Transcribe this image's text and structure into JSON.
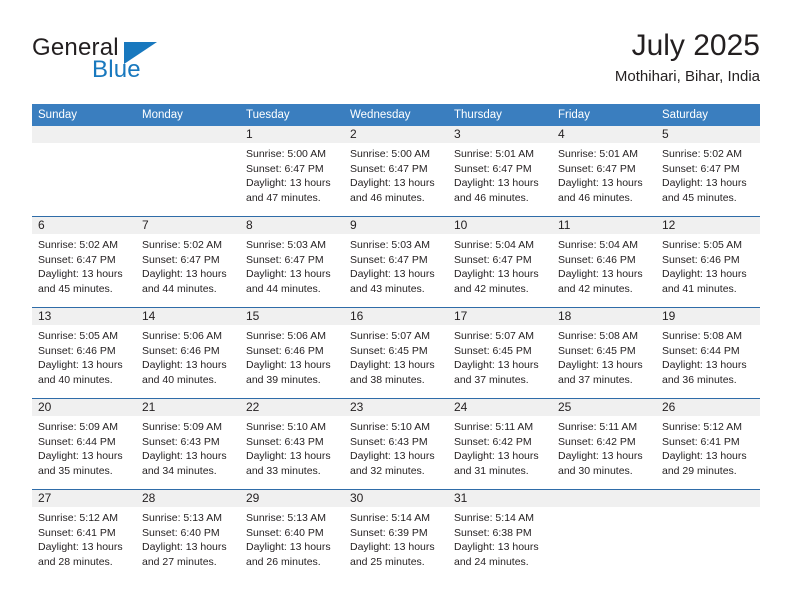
{
  "brand": {
    "name_top": "General",
    "name_bottom": "Blue",
    "triangle_icon": "triangle-icon",
    "accent_color": "#1878be"
  },
  "header": {
    "title": "July 2025",
    "subtitle": "Mothihari, Bihar, India"
  },
  "theme": {
    "header_blue": "#3a7ebf",
    "row_line_blue": "#2f6ca8",
    "daynum_band": "#f0f0f0"
  },
  "weekday_headers": [
    "Sunday",
    "Monday",
    "Tuesday",
    "Wednesday",
    "Thursday",
    "Friday",
    "Saturday"
  ],
  "weeks": [
    {
      "days": [
        {
          "num": "",
          "lines": []
        },
        {
          "num": "",
          "lines": []
        },
        {
          "num": "1",
          "lines": [
            "Sunrise: 5:00 AM",
            "Sunset: 6:47 PM",
            "Daylight: 13 hours",
            "and 47 minutes."
          ]
        },
        {
          "num": "2",
          "lines": [
            "Sunrise: 5:00 AM",
            "Sunset: 6:47 PM",
            "Daylight: 13 hours",
            "and 46 minutes."
          ]
        },
        {
          "num": "3",
          "lines": [
            "Sunrise: 5:01 AM",
            "Sunset: 6:47 PM",
            "Daylight: 13 hours",
            "and 46 minutes."
          ]
        },
        {
          "num": "4",
          "lines": [
            "Sunrise: 5:01 AM",
            "Sunset: 6:47 PM",
            "Daylight: 13 hours",
            "and 46 minutes."
          ]
        },
        {
          "num": "5",
          "lines": [
            "Sunrise: 5:02 AM",
            "Sunset: 6:47 PM",
            "Daylight: 13 hours",
            "and 45 minutes."
          ]
        }
      ]
    },
    {
      "days": [
        {
          "num": "6",
          "lines": [
            "Sunrise: 5:02 AM",
            "Sunset: 6:47 PM",
            "Daylight: 13 hours",
            "and 45 minutes."
          ]
        },
        {
          "num": "7",
          "lines": [
            "Sunrise: 5:02 AM",
            "Sunset: 6:47 PM",
            "Daylight: 13 hours",
            "and 44 minutes."
          ]
        },
        {
          "num": "8",
          "lines": [
            "Sunrise: 5:03 AM",
            "Sunset: 6:47 PM",
            "Daylight: 13 hours",
            "and 44 minutes."
          ]
        },
        {
          "num": "9",
          "lines": [
            "Sunrise: 5:03 AM",
            "Sunset: 6:47 PM",
            "Daylight: 13 hours",
            "and 43 minutes."
          ]
        },
        {
          "num": "10",
          "lines": [
            "Sunrise: 5:04 AM",
            "Sunset: 6:47 PM",
            "Daylight: 13 hours",
            "and 42 minutes."
          ]
        },
        {
          "num": "11",
          "lines": [
            "Sunrise: 5:04 AM",
            "Sunset: 6:46 PM",
            "Daylight: 13 hours",
            "and 42 minutes."
          ]
        },
        {
          "num": "12",
          "lines": [
            "Sunrise: 5:05 AM",
            "Sunset: 6:46 PM",
            "Daylight: 13 hours",
            "and 41 minutes."
          ]
        }
      ]
    },
    {
      "days": [
        {
          "num": "13",
          "lines": [
            "Sunrise: 5:05 AM",
            "Sunset: 6:46 PM",
            "Daylight: 13 hours",
            "and 40 minutes."
          ]
        },
        {
          "num": "14",
          "lines": [
            "Sunrise: 5:06 AM",
            "Sunset: 6:46 PM",
            "Daylight: 13 hours",
            "and 40 minutes."
          ]
        },
        {
          "num": "15",
          "lines": [
            "Sunrise: 5:06 AM",
            "Sunset: 6:46 PM",
            "Daylight: 13 hours",
            "and 39 minutes."
          ]
        },
        {
          "num": "16",
          "lines": [
            "Sunrise: 5:07 AM",
            "Sunset: 6:45 PM",
            "Daylight: 13 hours",
            "and 38 minutes."
          ]
        },
        {
          "num": "17",
          "lines": [
            "Sunrise: 5:07 AM",
            "Sunset: 6:45 PM",
            "Daylight: 13 hours",
            "and 37 minutes."
          ]
        },
        {
          "num": "18",
          "lines": [
            "Sunrise: 5:08 AM",
            "Sunset: 6:45 PM",
            "Daylight: 13 hours",
            "and 37 minutes."
          ]
        },
        {
          "num": "19",
          "lines": [
            "Sunrise: 5:08 AM",
            "Sunset: 6:44 PM",
            "Daylight: 13 hours",
            "and 36 minutes."
          ]
        }
      ]
    },
    {
      "days": [
        {
          "num": "20",
          "lines": [
            "Sunrise: 5:09 AM",
            "Sunset: 6:44 PM",
            "Daylight: 13 hours",
            "and 35 minutes."
          ]
        },
        {
          "num": "21",
          "lines": [
            "Sunrise: 5:09 AM",
            "Sunset: 6:43 PM",
            "Daylight: 13 hours",
            "and 34 minutes."
          ]
        },
        {
          "num": "22",
          "lines": [
            "Sunrise: 5:10 AM",
            "Sunset: 6:43 PM",
            "Daylight: 13 hours",
            "and 33 minutes."
          ]
        },
        {
          "num": "23",
          "lines": [
            "Sunrise: 5:10 AM",
            "Sunset: 6:43 PM",
            "Daylight: 13 hours",
            "and 32 minutes."
          ]
        },
        {
          "num": "24",
          "lines": [
            "Sunrise: 5:11 AM",
            "Sunset: 6:42 PM",
            "Daylight: 13 hours",
            "and 31 minutes."
          ]
        },
        {
          "num": "25",
          "lines": [
            "Sunrise: 5:11 AM",
            "Sunset: 6:42 PM",
            "Daylight: 13 hours",
            "and 30 minutes."
          ]
        },
        {
          "num": "26",
          "lines": [
            "Sunrise: 5:12 AM",
            "Sunset: 6:41 PM",
            "Daylight: 13 hours",
            "and 29 minutes."
          ]
        }
      ]
    },
    {
      "days": [
        {
          "num": "27",
          "lines": [
            "Sunrise: 5:12 AM",
            "Sunset: 6:41 PM",
            "Daylight: 13 hours",
            "and 28 minutes."
          ]
        },
        {
          "num": "28",
          "lines": [
            "Sunrise: 5:13 AM",
            "Sunset: 6:40 PM",
            "Daylight: 13 hours",
            "and 27 minutes."
          ]
        },
        {
          "num": "29",
          "lines": [
            "Sunrise: 5:13 AM",
            "Sunset: 6:40 PM",
            "Daylight: 13 hours",
            "and 26 minutes."
          ]
        },
        {
          "num": "30",
          "lines": [
            "Sunrise: 5:14 AM",
            "Sunset: 6:39 PM",
            "Daylight: 13 hours",
            "and 25 minutes."
          ]
        },
        {
          "num": "31",
          "lines": [
            "Sunrise: 5:14 AM",
            "Sunset: 6:38 PM",
            "Daylight: 13 hours",
            "and 24 minutes."
          ]
        },
        {
          "num": "",
          "lines": []
        },
        {
          "num": "",
          "lines": []
        }
      ]
    }
  ]
}
